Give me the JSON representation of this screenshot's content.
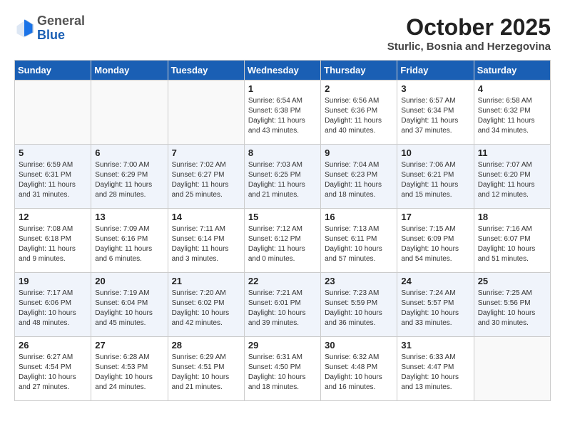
{
  "header": {
    "logo_general": "General",
    "logo_blue": "Blue",
    "month_year": "October 2025",
    "location": "Sturlic, Bosnia and Herzegovina"
  },
  "days_of_week": [
    "Sunday",
    "Monday",
    "Tuesday",
    "Wednesday",
    "Thursday",
    "Friday",
    "Saturday"
  ],
  "weeks": [
    [
      {
        "day": "",
        "info": ""
      },
      {
        "day": "",
        "info": ""
      },
      {
        "day": "",
        "info": ""
      },
      {
        "day": "1",
        "info": "Sunrise: 6:54 AM\nSunset: 6:38 PM\nDaylight: 11 hours\nand 43 minutes."
      },
      {
        "day": "2",
        "info": "Sunrise: 6:56 AM\nSunset: 6:36 PM\nDaylight: 11 hours\nand 40 minutes."
      },
      {
        "day": "3",
        "info": "Sunrise: 6:57 AM\nSunset: 6:34 PM\nDaylight: 11 hours\nand 37 minutes."
      },
      {
        "day": "4",
        "info": "Sunrise: 6:58 AM\nSunset: 6:32 PM\nDaylight: 11 hours\nand 34 minutes."
      }
    ],
    [
      {
        "day": "5",
        "info": "Sunrise: 6:59 AM\nSunset: 6:31 PM\nDaylight: 11 hours\nand 31 minutes."
      },
      {
        "day": "6",
        "info": "Sunrise: 7:00 AM\nSunset: 6:29 PM\nDaylight: 11 hours\nand 28 minutes."
      },
      {
        "day": "7",
        "info": "Sunrise: 7:02 AM\nSunset: 6:27 PM\nDaylight: 11 hours\nand 25 minutes."
      },
      {
        "day": "8",
        "info": "Sunrise: 7:03 AM\nSunset: 6:25 PM\nDaylight: 11 hours\nand 21 minutes."
      },
      {
        "day": "9",
        "info": "Sunrise: 7:04 AM\nSunset: 6:23 PM\nDaylight: 11 hours\nand 18 minutes."
      },
      {
        "day": "10",
        "info": "Sunrise: 7:06 AM\nSunset: 6:21 PM\nDaylight: 11 hours\nand 15 minutes."
      },
      {
        "day": "11",
        "info": "Sunrise: 7:07 AM\nSunset: 6:20 PM\nDaylight: 11 hours\nand 12 minutes."
      }
    ],
    [
      {
        "day": "12",
        "info": "Sunrise: 7:08 AM\nSunset: 6:18 PM\nDaylight: 11 hours\nand 9 minutes."
      },
      {
        "day": "13",
        "info": "Sunrise: 7:09 AM\nSunset: 6:16 PM\nDaylight: 11 hours\nand 6 minutes."
      },
      {
        "day": "14",
        "info": "Sunrise: 7:11 AM\nSunset: 6:14 PM\nDaylight: 11 hours\nand 3 minutes."
      },
      {
        "day": "15",
        "info": "Sunrise: 7:12 AM\nSunset: 6:12 PM\nDaylight: 11 hours\nand 0 minutes."
      },
      {
        "day": "16",
        "info": "Sunrise: 7:13 AM\nSunset: 6:11 PM\nDaylight: 10 hours\nand 57 minutes."
      },
      {
        "day": "17",
        "info": "Sunrise: 7:15 AM\nSunset: 6:09 PM\nDaylight: 10 hours\nand 54 minutes."
      },
      {
        "day": "18",
        "info": "Sunrise: 7:16 AM\nSunset: 6:07 PM\nDaylight: 10 hours\nand 51 minutes."
      }
    ],
    [
      {
        "day": "19",
        "info": "Sunrise: 7:17 AM\nSunset: 6:06 PM\nDaylight: 10 hours\nand 48 minutes."
      },
      {
        "day": "20",
        "info": "Sunrise: 7:19 AM\nSunset: 6:04 PM\nDaylight: 10 hours\nand 45 minutes."
      },
      {
        "day": "21",
        "info": "Sunrise: 7:20 AM\nSunset: 6:02 PM\nDaylight: 10 hours\nand 42 minutes."
      },
      {
        "day": "22",
        "info": "Sunrise: 7:21 AM\nSunset: 6:01 PM\nDaylight: 10 hours\nand 39 minutes."
      },
      {
        "day": "23",
        "info": "Sunrise: 7:23 AM\nSunset: 5:59 PM\nDaylight: 10 hours\nand 36 minutes."
      },
      {
        "day": "24",
        "info": "Sunrise: 7:24 AM\nSunset: 5:57 PM\nDaylight: 10 hours\nand 33 minutes."
      },
      {
        "day": "25",
        "info": "Sunrise: 7:25 AM\nSunset: 5:56 PM\nDaylight: 10 hours\nand 30 minutes."
      }
    ],
    [
      {
        "day": "26",
        "info": "Sunrise: 6:27 AM\nSunset: 4:54 PM\nDaylight: 10 hours\nand 27 minutes."
      },
      {
        "day": "27",
        "info": "Sunrise: 6:28 AM\nSunset: 4:53 PM\nDaylight: 10 hours\nand 24 minutes."
      },
      {
        "day": "28",
        "info": "Sunrise: 6:29 AM\nSunset: 4:51 PM\nDaylight: 10 hours\nand 21 minutes."
      },
      {
        "day": "29",
        "info": "Sunrise: 6:31 AM\nSunset: 4:50 PM\nDaylight: 10 hours\nand 18 minutes."
      },
      {
        "day": "30",
        "info": "Sunrise: 6:32 AM\nSunset: 4:48 PM\nDaylight: 10 hours\nand 16 minutes."
      },
      {
        "day": "31",
        "info": "Sunrise: 6:33 AM\nSunset: 4:47 PM\nDaylight: 10 hours\nand 13 minutes."
      },
      {
        "day": "",
        "info": ""
      }
    ]
  ]
}
